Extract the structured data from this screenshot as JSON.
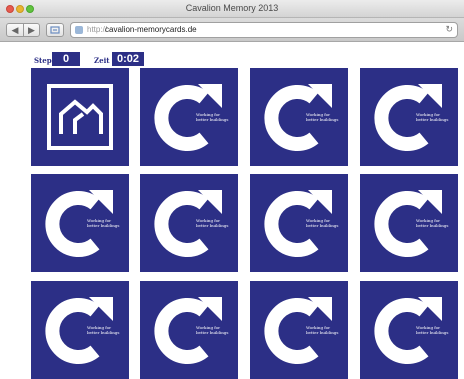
{
  "window": {
    "title": "Cavalion Memory 2013"
  },
  "browser": {
    "back_label": "◀",
    "forward_label": "▶",
    "url_prefix": "http://",
    "url": "cavalion-memorycards.de",
    "reload_icon": "reload-icon"
  },
  "game": {
    "steps_label": "Steps",
    "steps_value": "0",
    "time_label": "Zeit",
    "time_value": "0:02",
    "card_line1": "Working for",
    "card_line2": "better buildings",
    "brand_color": "#2c2f86",
    "cards": [
      {
        "state": "face-up",
        "icon": "house-icon"
      },
      {
        "state": "face-down",
        "icon": "logo-icon"
      },
      {
        "state": "face-down",
        "icon": "logo-icon"
      },
      {
        "state": "face-down",
        "icon": "logo-icon"
      },
      {
        "state": "face-down",
        "icon": "logo-icon"
      },
      {
        "state": "face-down",
        "icon": "logo-icon"
      },
      {
        "state": "face-down",
        "icon": "logo-icon"
      },
      {
        "state": "face-down",
        "icon": "logo-icon"
      },
      {
        "state": "face-down",
        "icon": "logo-icon"
      },
      {
        "state": "face-down",
        "icon": "logo-icon"
      },
      {
        "state": "face-down",
        "icon": "logo-icon"
      },
      {
        "state": "face-down",
        "icon": "logo-icon"
      }
    ]
  }
}
